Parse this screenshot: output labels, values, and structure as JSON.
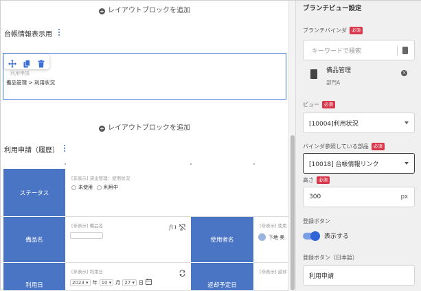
{
  "editor": {
    "add_block_label": "レイアウトブロックを追加",
    "block1_title": "台帳情報表示用",
    "block1_faint_label": "利用申請",
    "block1_breadcrumb": "備品管理 > 利用状況",
    "block2_title": "利用申請（履歴）",
    "table": {
      "row1_header": "ステータス",
      "row1_hidden": "[非表示] 貸出管理：使用状況",
      "row1_options": [
        "未使用",
        "利用中"
      ],
      "row2_header": "備品名",
      "row2_hidden": "[非表示] 備品名",
      "row2_right_header": "使用者名",
      "row2_right_hidden": "[非表示] 使用",
      "row2_right_user": "下地 美",
      "row3_header": "利用日",
      "row3_hidden": "[非表示] 利用日",
      "row3_date": {
        "year": "2023",
        "year_unit": "年",
        "month": "10",
        "month_unit": "月",
        "day": "27",
        "day_unit": "日"
      },
      "row3_right_header": "返却予定日",
      "row3_right_hidden": "[非表示] 返却"
    }
  },
  "panel": {
    "title": "ブランチビュー設定",
    "binder_label": "ブランチバインダ",
    "required": "必須",
    "search_placeholder": "キーワードで検索",
    "binder_item_title": "備品管理",
    "binder_item_sub": "部門A",
    "view_label": "ビュー",
    "view_value": "[10004]利用状況",
    "parts_label": "バインダ参照している部品",
    "parts_value": "[10018] 台帳情報リンク",
    "height_label": "高さ",
    "height_value": "300",
    "height_unit": "px",
    "register_button_label": "登録ボタン",
    "toggle_label": "表示する",
    "toggle_on": true,
    "register_button_ja_label": "登録ボタン（日本語）",
    "register_button_ja_value": "利用申請"
  },
  "colors": {
    "accent": "#3a6fd8",
    "table_header": "#4a74c4",
    "required": "#d9374b"
  },
  "icons": [
    "plus-circle-icon",
    "kebab-menu-icon",
    "move-icon",
    "copy-icon",
    "trash-icon",
    "book-icon",
    "close-circle-icon",
    "chevron-down-icon",
    "function-icon",
    "unlink-icon",
    "refresh-icon",
    "calendar-icon",
    "user-avatar-icon"
  ]
}
